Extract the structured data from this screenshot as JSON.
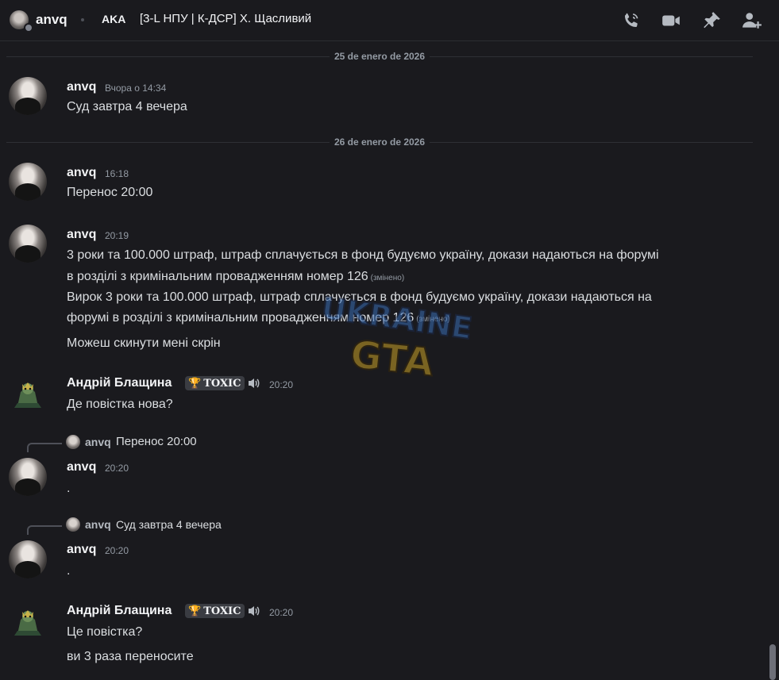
{
  "header": {
    "user": "anvq",
    "aka_label": "AKA",
    "nickname": "[3-L НПУ | К-ДСР] Х. Щасливий"
  },
  "dividers": [
    "25 de enero de 2026",
    "26 de enero de 2026"
  ],
  "messages": [
    {
      "author": "anvq",
      "time": "Вчора о 14:34",
      "lines": [
        "Суд завтра 4 вечера"
      ]
    },
    {
      "author": "anvq",
      "time": "16:18",
      "lines": [
        "Перенос 20:00"
      ]
    },
    {
      "author": "anvq",
      "time": "20:19",
      "lines": [
        "3 роки та 100.000 штраф, штраф сплачується в фонд будуємо україну, докази надаються на форумі",
        "в розділі з кримінальним провадженням номер 126",
        "Вирок 3 роки та 100.000 штраф, штраф сплачується в фонд будуємо україну, докази надаються на",
        "форумі в розділі з кримінальним провадженням номер 126",
        "Можеш скинути мені скрін"
      ],
      "edited": "(змінено)"
    },
    {
      "author": "Андрій Блащина",
      "tag": "TOXIC",
      "time": "20:20",
      "lines": [
        "Де повістка нова?"
      ]
    },
    {
      "reply_author": "anvq",
      "reply_text": "Перенос 20:00",
      "author": "anvq",
      "time": "20:20",
      "lines": [
        "."
      ]
    },
    {
      "reply_author": "anvq",
      "reply_text": "Суд завтра 4 вечера",
      "author": "anvq",
      "time": "20:20",
      "lines": [
        "."
      ]
    },
    {
      "author": "Андрій Блащина",
      "tag": "TOXIC",
      "time": "20:20",
      "lines": [
        "Це повістка?",
        "ви 3 раза переносите"
      ]
    }
  ],
  "watermark": {
    "line1": "UKRAINE",
    "line2": "GTA"
  },
  "icons": [
    "phone-icon",
    "video-icon",
    "pin-icon",
    "add-friend-icon",
    "speaker-icon",
    "trophy-icon"
  ],
  "colors": {
    "background": "#1a1a1e",
    "text": "#dbdee1",
    "muted": "#949ba4",
    "tag_green": "#3ba55c"
  }
}
